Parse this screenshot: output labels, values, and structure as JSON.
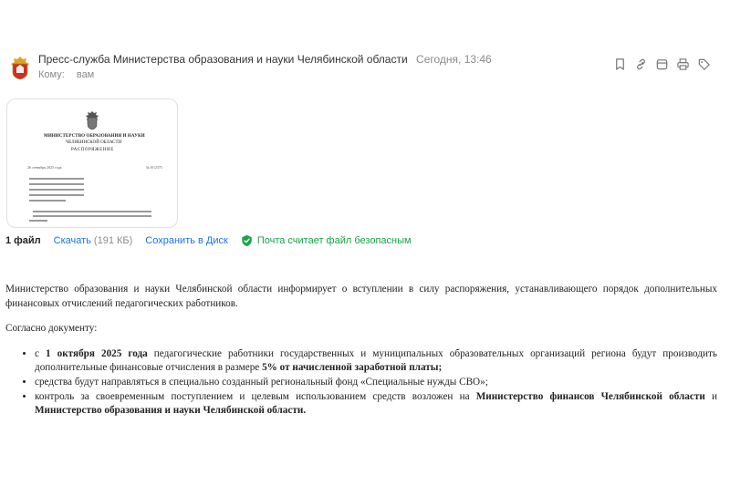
{
  "sender": {
    "name": "Пресс-служба Министерства образования и науки Челябинской области",
    "date": "Сегодня, 13:46",
    "to_label": "Кому:",
    "to_value": "вам"
  },
  "toolbar": {
    "icons": [
      "bookmark-icon",
      "link-icon",
      "calendar-icon",
      "print-icon",
      "tag-icon"
    ]
  },
  "attachment_preview": {
    "title_line1": "МИНИСТЕРСТВО ОБРАЗОВАНИЯ И НАУКИ",
    "title_line2": "ЧЕЛЯБИНСКОЙ ОБЛАСТИ",
    "title_line3": "РАСПОРЯЖЕНИЕ",
    "date": "26 сентября 2025 года",
    "number": "№ 01/2375"
  },
  "attachment_bar": {
    "count": "1 файл",
    "download": "Скачать",
    "size": "(191 КБ)",
    "save_to_disk": "Сохранить в Диск",
    "safe_text": "Почта считает файл безопасным"
  },
  "body": {
    "intro": "Министерство образования и науки Челябинской области информирует о вступлении в силу распоряжения, устанавливающего порядок дополнительных финансовых отчислений педагогических работников.",
    "according": "Согласно документу:",
    "b1_pre": "с ",
    "b1_date": "1 октября 2025 года",
    "b1_mid": " педагогические работники государственных и муниципальных образовательных организаций региона будут производить дополнительные финансовые отчисления в размере ",
    "b1_bold": "5% от начисленной заработной платы;",
    "b2": "средства будут направляться в специально созданный региональный фонд «Специальные нужды СВО»;",
    "b3_pre": "контроль за своевременным поступлением и целевым использованием средств возложен на ",
    "b3_bold1": "Министерство финансов Челябинской области",
    "b3_mid": " и ",
    "b3_bold2": "Министерство образования и науки Челябинской области."
  }
}
